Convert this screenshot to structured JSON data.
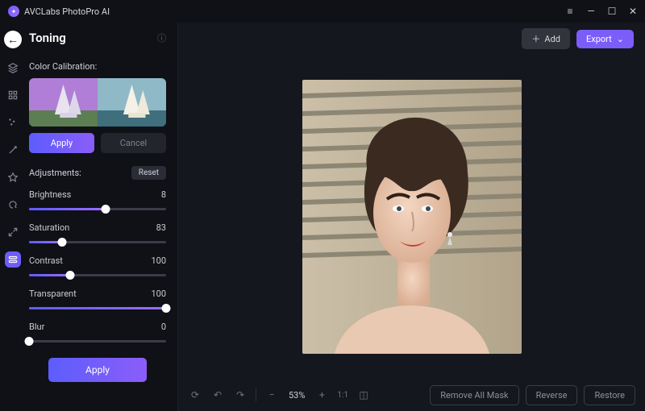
{
  "app": {
    "title": "AVCLabs PhotoPro AI"
  },
  "window": {
    "menu_icon": "menu-icon",
    "minimize_icon": "minimize-icon",
    "maximize_icon": "maximize-icon",
    "close_icon": "close-icon"
  },
  "panel": {
    "title": "Toning",
    "info_icon": "info-icon",
    "color_calibration_label": "Color Calibration:",
    "apply_label": "Apply",
    "cancel_label": "Cancel",
    "adjustments_label": "Adjustments:",
    "reset_label": "Reset",
    "big_apply_label": "Apply"
  },
  "sliders": [
    {
      "label": "Brightness",
      "value": 8,
      "max": 100,
      "pct": 56
    },
    {
      "label": "Saturation",
      "value": 83,
      "max": 100,
      "pct": 24
    },
    {
      "label": "Contrast",
      "value": 100,
      "max": 100,
      "pct": 30
    },
    {
      "label": "Transparent",
      "value": 100,
      "max": 100,
      "pct": 100
    },
    {
      "label": "Blur",
      "value": 0,
      "max": 100,
      "pct": 0
    }
  ],
  "toolbar_icons": [
    "back-icon",
    "layers-icon",
    "selection-icon",
    "sparkle-icon",
    "magic-icon",
    "crop-icon",
    "paint-icon",
    "expand-icon",
    "toning-icon"
  ],
  "topbar": {
    "add_label": "Add",
    "export_label": "Export"
  },
  "bottombar": {
    "refresh_icon": "refresh-icon",
    "undo_icon": "undo-icon",
    "redo_icon": "redo-icon",
    "zoom_out": "−",
    "zoom": "53%",
    "zoom_in": "+",
    "fit_label": "1:1",
    "compare_icon": "compare-icon",
    "remove_mask_label": "Remove All Mask",
    "reverse_label": "Reverse",
    "restore_label": "Restore"
  },
  "colors": {
    "accent": "#7b5df9",
    "bg": "#0f1117",
    "canvas": "#15171e"
  }
}
